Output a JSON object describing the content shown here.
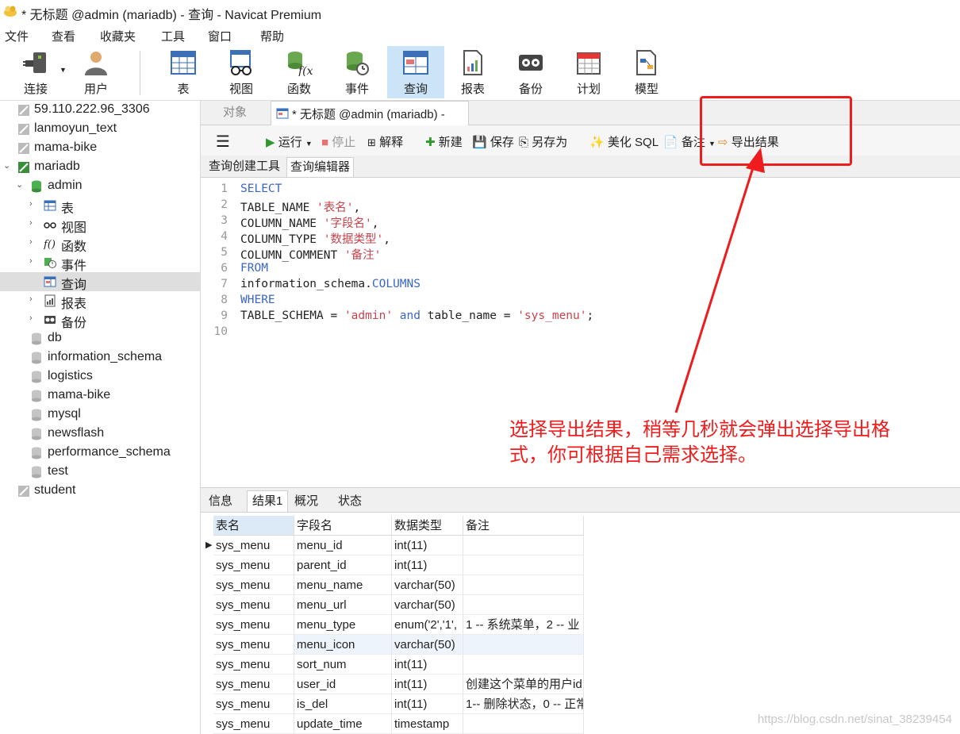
{
  "window": {
    "title": "* 无标题 @admin (mariadb) - 查询 - Navicat Premium"
  },
  "menu": [
    "文件",
    "查看",
    "收藏夹",
    "工具",
    "窗口",
    "帮助"
  ],
  "toolbar": {
    "connect": "连接",
    "user": "用户",
    "table": "表",
    "view": "视图",
    "function": "函数",
    "event": "事件",
    "query": "查询",
    "report": "报表",
    "backup": "备份",
    "schedule": "计划",
    "model": "模型"
  },
  "sidebar": {
    "items": [
      {
        "label": "59.110.222.96_3306"
      },
      {
        "label": "lanmoyun_text"
      },
      {
        "label": "mama-bike"
      },
      {
        "label": "mariadb"
      },
      {
        "label": "admin"
      },
      {
        "label": "表"
      },
      {
        "label": "视图"
      },
      {
        "label": "函数"
      },
      {
        "label": "事件"
      },
      {
        "label": "查询"
      },
      {
        "label": "报表"
      },
      {
        "label": "备份"
      },
      {
        "label": "db"
      },
      {
        "label": "information_schema"
      },
      {
        "label": "logistics"
      },
      {
        "label": "mama-bike"
      },
      {
        "label": "mysql"
      },
      {
        "label": "newsflash"
      },
      {
        "label": "performance_schema"
      },
      {
        "label": "test"
      },
      {
        "label": "student"
      }
    ]
  },
  "tabs": {
    "objects": "对象",
    "query": "* 无标题 @admin (mariadb) -"
  },
  "query_toolbar": {
    "run": "运行",
    "stop": "停止",
    "explain": "解释",
    "new": "新建",
    "save": "保存",
    "save_as": "另存为",
    "beautify": "美化 SQL",
    "comment": "备注",
    "export": "导出结果"
  },
  "subtabs": {
    "builder": "查询创建工具",
    "editor": "查询编辑器"
  },
  "editor": {
    "line_numbers": [
      "1",
      "2",
      "3",
      "4",
      "5",
      "6",
      "7",
      "8",
      "9",
      "10"
    ],
    "l1": "SELECT",
    "l2a": "TABLE_NAME ",
    "l2b": "'表名'",
    "l2c": ",",
    "l3a": "COLUMN_NAME ",
    "l3b": "'字段名'",
    "l3c": ",",
    "l4a": "COLUMN_TYPE ",
    "l4b": "'数据类型'",
    "l4c": ",",
    "l5a": "COLUMN_COMMENT ",
    "l5b": "'备注'",
    "l6": "FROM",
    "l7a": "information_schema.",
    "l7b": "COLUMNS",
    "l8": "WHERE",
    "l9a": "TABLE_SCHEMA = ",
    "l9b": "'admin'",
    "l9c": " and",
    "l9d": " table_name = ",
    "l9e": "'sys_menu'",
    "l9f": ";"
  },
  "annotation": {
    "text": "选择导出结果，稍等几秒就会弹出选择导出格式，你可根据自己需求选择。"
  },
  "result_tabs": {
    "info": "信息",
    "result1": "结果1",
    "overview": "概况",
    "status": "状态"
  },
  "grid": {
    "headers": [
      "表名",
      "字段名",
      "数据类型",
      "备注"
    ],
    "rows": [
      {
        "t": "sys_menu",
        "f": "menu_id",
        "d": "int(11)",
        "c": ""
      },
      {
        "t": "sys_menu",
        "f": "parent_id",
        "d": "int(11)",
        "c": ""
      },
      {
        "t": "sys_menu",
        "f": "menu_name",
        "d": "varchar(50)",
        "c": ""
      },
      {
        "t": "sys_menu",
        "f": "menu_url",
        "d": "varchar(50)",
        "c": ""
      },
      {
        "t": "sys_menu",
        "f": "menu_type",
        "d": "enum('2','1',",
        "c": "1 -- 系统菜单，2 -- 业"
      },
      {
        "t": "sys_menu",
        "f": "menu_icon",
        "d": "varchar(50)",
        "c": ""
      },
      {
        "t": "sys_menu",
        "f": "sort_num",
        "d": "int(11)",
        "c": ""
      },
      {
        "t": "sys_menu",
        "f": "user_id",
        "d": "int(11)",
        "c": "创建这个菜单的用户id"
      },
      {
        "t": "sys_menu",
        "f": "is_del",
        "d": "int(11)",
        "c": "1-- 删除状态，0 -- 正常"
      },
      {
        "t": "sys_menu",
        "f": "update_time",
        "d": "timestamp",
        "c": ""
      }
    ]
  },
  "watermark": "https://blog.csdn.net/sinat_38239454",
  "colors": {
    "accent_red": "#ee1c1c",
    "active_tool": "#cce4f7",
    "keyword": "#3a66c4",
    "string": "#c8434b"
  }
}
